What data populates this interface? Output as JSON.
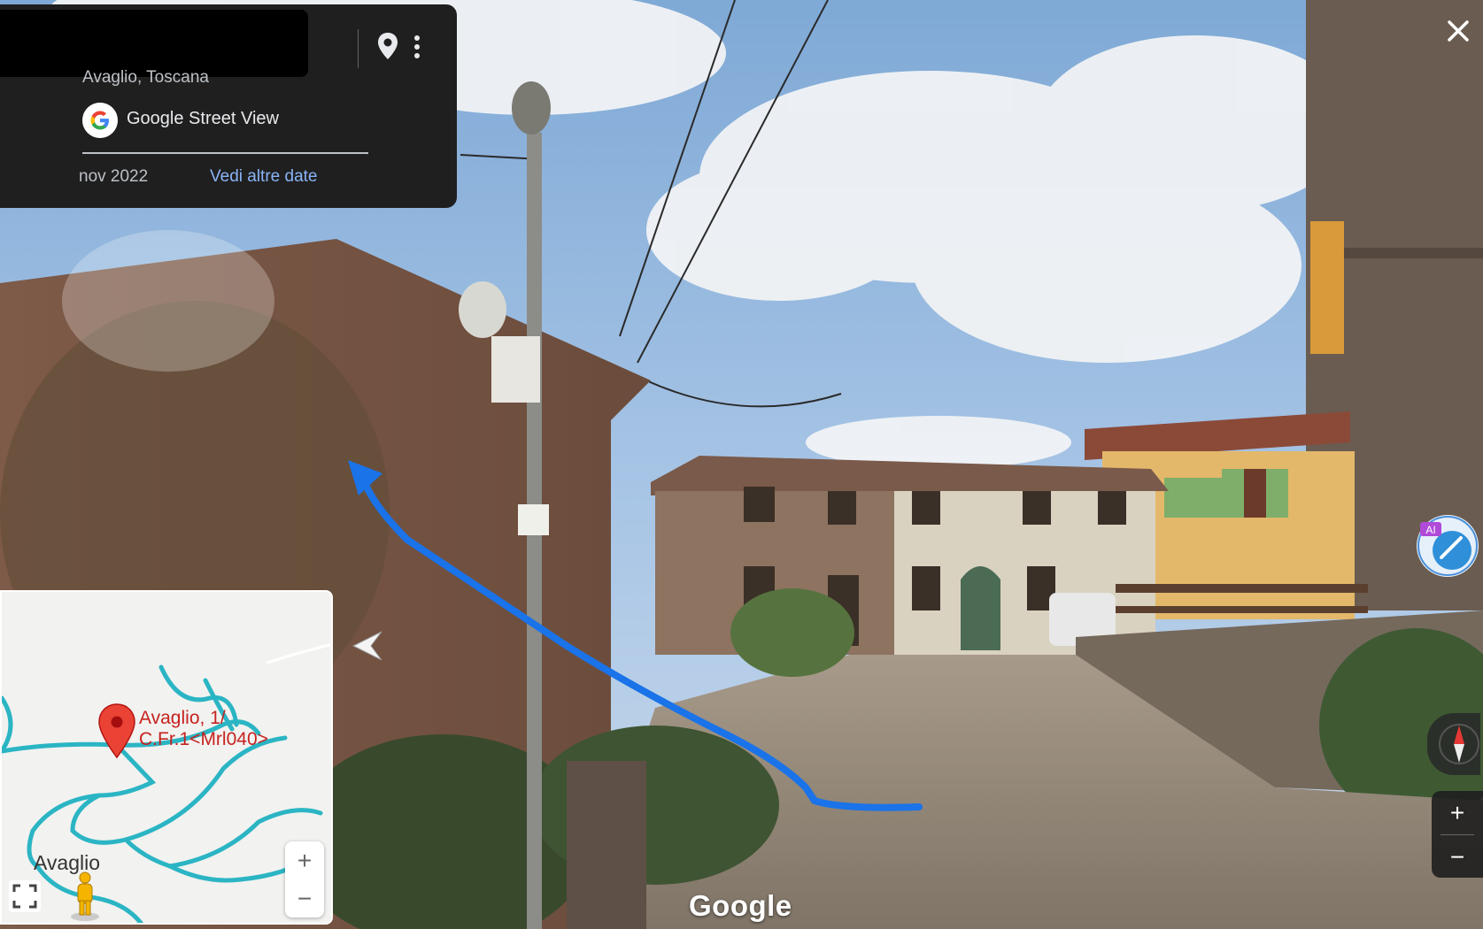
{
  "card": {
    "place": "Avaglio, Toscana",
    "provider": "Google Street View",
    "date": "nov 2022",
    "more_dates": "Vedi altre date"
  },
  "minimap": {
    "marker_label_line1": "Avaglio, 1/",
    "marker_label_line2": "C.Fr.1<Mrl040>",
    "town": "Avaglio",
    "zoom_in": "+",
    "zoom_out": "−"
  },
  "controls": {
    "zoom_in": "+",
    "zoom_out": "−",
    "ai_badge": "AI"
  },
  "watermark": "Google",
  "colors": {
    "card_bg": "#1f1f1f",
    "link": "#8ab4f8",
    "annotation_arrow": "#1a73e8",
    "map_roads": "#2bb5c4",
    "map_marker": "#ea4335"
  },
  "icons": [
    "pin-icon",
    "more-vert-icon",
    "google-g-icon",
    "close-icon",
    "fullscreen-icon",
    "pegman-icon",
    "compass-icon",
    "nav-left-arrow-icon"
  ]
}
